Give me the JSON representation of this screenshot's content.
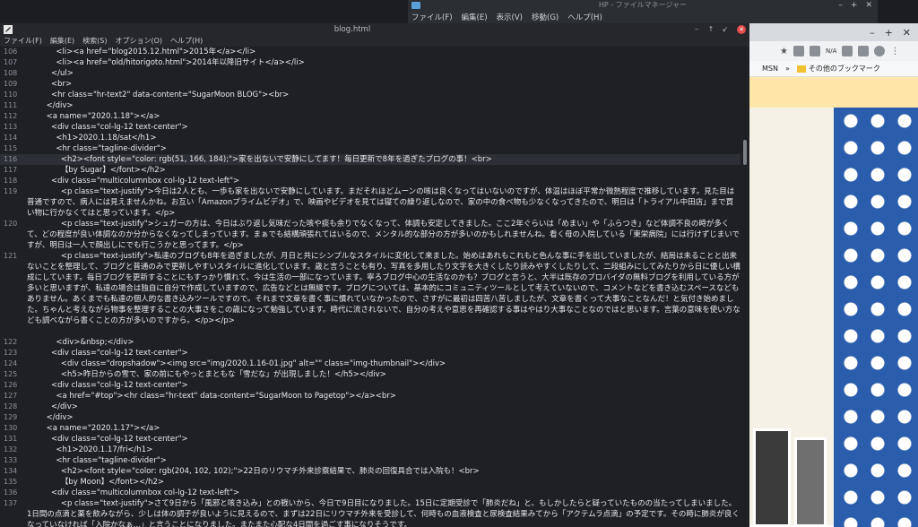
{
  "file_manager": {
    "title": "HP - ファイルマネージャー",
    "menu": [
      "ファイル(F)",
      "編集(E)",
      "表示(V)",
      "移動(G)",
      "ヘルプ(H)"
    ],
    "controls": [
      "–",
      "+",
      "✕"
    ]
  },
  "browser": {
    "tab_controls": [
      "–",
      "+",
      "✕"
    ],
    "toolbar_badge": "N/A",
    "bookmarks": [
      "MSN",
      "»",
      "その他のブックマーク"
    ]
  },
  "editor": {
    "title": "blog.html",
    "window_controls": [
      "–",
      "↑",
      "↙",
      "✕"
    ],
    "menu": [
      "ファイル(F)",
      "編集(E)",
      "検索(S)",
      "オプション(O)",
      "ヘルプ(H)"
    ]
  },
  "lines": [
    {
      "n": "106",
      "t": "            <li><a href=\"blog2015.12.html\">2015年</a></li>",
      "h": 12
    },
    {
      "n": "107",
      "t": "            <li><a href=\"old/hitorigoto.html\">2014年以降旧サイト</a></li>",
      "h": 12
    },
    {
      "n": "108",
      "t": "          </ul>",
      "h": 12
    },
    {
      "n": "109",
      "t": "          <br>",
      "h": 12
    },
    {
      "n": "110",
      "t": "          <hr class=\"hr-text2\" data-content=\"SugarMoon BLOG\"><br>",
      "h": 12
    },
    {
      "n": "111",
      "t": "        </div>",
      "h": 12
    },
    {
      "n": "112",
      "t": "        <a name=\"2020.1.18\"></a>",
      "h": 12
    },
    {
      "n": "113",
      "t": "          <div class=\"col-lg-12 text-center\">",
      "h": 12
    },
    {
      "n": "114",
      "t": "            <h1>2020.1.18/sat</h1>",
      "h": 12
    },
    {
      "n": "115",
      "t": "            <hr class=\"tagline-divider\">",
      "h": 12
    },
    {
      "n": "116",
      "t": "              <h2><font style=\"color: rgb(51, 166, 184);\">家を出ないで安静にしてます！毎日更新で8年を過ぎたブログの事！<br>",
      "h": 12,
      "hl": true
    },
    {
      "n": "117",
      "t": "              【by Sugar】</font></h2>",
      "h": 12
    },
    {
      "n": "118",
      "t": "          <div class=\"multicolumnbox col-lg-12 text-left\">",
      "h": 12
    },
    {
      "n": "119",
      "t": "              <p class=\"text-justify\">今日は2人とも、一歩も家を出ないで安静にしています。まだそれほどムーンの咳は良くなってはいないのですが、体温はほぼ平常か微熱程度で推移しています。見た目は普通ですので、病人には見えませんかね。お互い「Amazonプライムビデオ」で、映画やビデオを見ては寝ての繰り返しなので、家の中の食べ物も少なくなってきたので、明日は「トライアル中田店」まで買い物に行かなくてはと思っています。</p>",
      "h": 36
    },
    {
      "n": "120",
      "t": "              <p class=\"text-justify\">シュガーの方は、今日はぶり返し気味だった咳や痰も余りでなくなって、体調も安定してきました。ここ2年ぐらいは「めまい」や「ふらつき」など体調不良の時が多くて、どの程度が良い体調なのか分からなくなってしまっています。まぁでも結構頑張れてはいるので、メンタル的な部分の方が多いのかもしれませんね。看く母の入院している「東栄病院」には行けずじまいですが、明日は一人で顔出しにでも行こうかと思ってます。</p>",
      "h": 36
    },
    {
      "n": "121",
      "t": "              <p class=\"text-justify\">私達のブログも8年を過ぎましたが、月日と共にシンプルなスタイルに変化して来ました。始めはあれもこれもと色んな事に手を出していましたが、結局は未ることと出来ないことを整理して、ブログと普通のみで更新しやすいスタイルに進化しています。歳と言うことも有り、写真を多用したり文字を大きくしたり読みやすくしたりして、二段組みにしてみたりから日に優しい構成にしています。毎日ブログを更新することにもすっかり慣れて、今は生活の一部になっています。寧ろブログ中心の生活なのかも？ブログと言うと、大半は既存のプロバイダの無料ブログを利用している方が多いと思いますが、私達の場合は独自に自分で作成していますので、広告などとは無縁です。ブログについては、基本的にコミュニティツールとして考えていないので、コメントなどを書き込むスペースなどもありません。あくまでも私達の個人的な書き込みツールですので。それまで文章を書く事に慣れていなかったので、さすがに最初は四苦八苦しましたが、文章を書くって大事なことなんだ！と気付き始めました。ちゃんと考えながら物事を整理することの大事さをこの歳になって勉強しています。時代に流されないで、自分の考えや意思を再確認する事はやはり大事なことなのではと思います。言葉の意味を使い方なども調べながら書くことの方が多いのですから。</p></p>",
      "h": 96
    },
    {
      "n": "122",
      "t": "            <div>&nbsp;</div>",
      "h": 12
    },
    {
      "n": "123",
      "t": "          <div class=\"col-lg-12 text-center\">",
      "h": 12
    },
    {
      "n": "124",
      "t": "              <div class=\"dropshadow\"><img src=\"img/2020.1.16-01.jpg\" alt=\"\" class=\"img-thumbnail\"></div>",
      "h": 12
    },
    {
      "n": "125",
      "t": "              <h5>昨日からの雪で、家の前にもやっとまともな「雪だな」が出現しました！</h5></div>",
      "h": 12
    },
    {
      "n": "126",
      "t": "          <div class=\"col-lg-12 text-center\">",
      "h": 12
    },
    {
      "n": "127",
      "t": "            <a href=\"#top\"><hr class=\"hr-text\" data-content=\"SugarMoon to Pagetop\"></a><br>",
      "h": 12
    },
    {
      "n": "128",
      "t": "          </div>",
      "h": 12
    },
    {
      "n": "129",
      "t": "        </div>",
      "h": 12
    },
    {
      "n": "130",
      "t": "        <a name=\"2020.1.17\"></a>",
      "h": 12
    },
    {
      "n": "131",
      "t": "          <div class=\"col-lg-12 text-center\">",
      "h": 12
    },
    {
      "n": "132",
      "t": "            <h1>2020.1.17/fri</h1>",
      "h": 12
    },
    {
      "n": "133",
      "t": "            <hr class=\"tagline-divider\">",
      "h": 12
    },
    {
      "n": "134",
      "t": "              <h2><font style=\"color: rgb(204, 102, 102);\">22日のリウマチ外来診察結果で、肺炎の回復具合では入院も！<br>",
      "h": 12
    },
    {
      "n": "135",
      "t": "              【by Moon】</font></h2>",
      "h": 12
    },
    {
      "n": "136",
      "t": "          <div class=\"multicolumnbox col-lg-12 text-left\">",
      "h": 12
    },
    {
      "n": "137",
      "t": "              <p class=\"text-justify\">さて9日から「風邪と咳き込み」との戦いから、今日で9日目になりました。15日に定期受診で「肺炎だね」と、もしかしたらと疑っていたものの当たってしまいました。1日間の点滴と薬を飲みながら、少しは体の調子が良いように見えるので、まずは22日にリウマチ外来を受診して、何時もの血液検査と尿検査結果みてから「アクテムラ点滴」の予定です。その時に肺炎が良くなっていなければ「入院かなぁ…」と言うことになりました。またまた心配な4日間を過ごす事になりそうです。",
      "h": 36
    }
  ]
}
